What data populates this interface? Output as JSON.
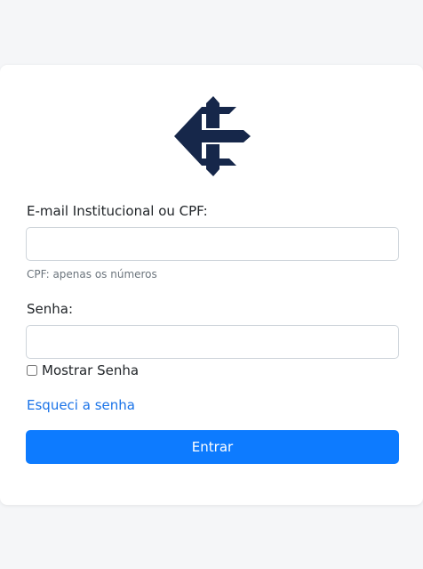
{
  "login": {
    "email_label": "E-mail Institucional ou CPF:",
    "email_value": "",
    "email_help": "CPF: apenas os números",
    "password_label": "Senha:",
    "password_value": "",
    "show_password_label": "Mostrar Senha",
    "forgot_password_link": "Esqueci a senha",
    "submit_label": "Entrar"
  },
  "colors": {
    "logo": "#16274a",
    "primary_button": "#0d7bff",
    "link": "#1a73e8",
    "page_background": "#f5f6f8"
  },
  "icons": {
    "logo": "institution-logo-icon"
  }
}
